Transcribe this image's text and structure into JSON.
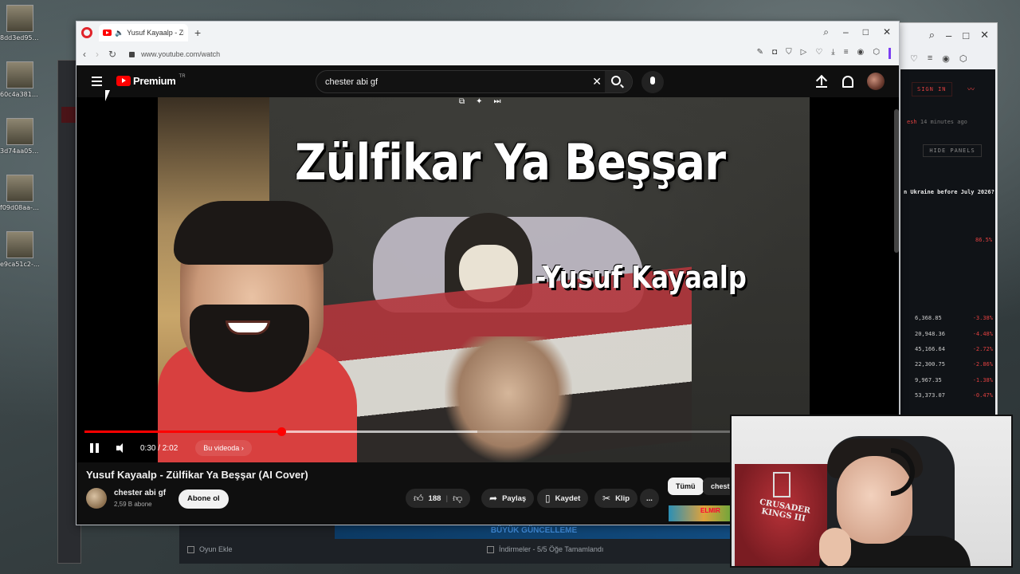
{
  "desktop": {
    "icons": [
      {
        "label": "8dd3ed95-f..."
      },
      {
        "label": "60c4a381-c..."
      },
      {
        "label": "3d74aa05-a..."
      },
      {
        "label": "f09d08aa-b..."
      },
      {
        "label": "e9ca51c2-c..."
      }
    ]
  },
  "browser": {
    "tab_title": "Yusuf Kayaalp - Zülfik",
    "new_tab": "+",
    "url": "www.youtube.com/watch"
  },
  "youtube": {
    "logo_text": "Premium",
    "logo_sup": "TR",
    "search_value": "chester abi gf",
    "video": {
      "overlay_title": "Zülfikar Ya Beşşar",
      "overlay_artist": "-Yusuf Kayaalp",
      "time": "0:30 / 2:02",
      "chapter": "Bu videoda",
      "progress_played": 0.274,
      "progress_buffered": 0.548
    },
    "title": "Yusuf Kayaalp - Zülfikar Ya Beşşar (AI Cover)",
    "channel": {
      "name": "chester abi gf",
      "subs": "2,59 B abone",
      "subscribe": "Abone ol"
    },
    "actions": {
      "likes": "188",
      "share": "Paylaş",
      "save": "Kaydet",
      "clip": "Klip",
      "more": "..."
    },
    "chips": [
      "Tümü",
      "chest"
    ]
  },
  "background": {
    "bottom_banner": "BÜYÜK GÜNCELLEME",
    "add_game": "Oyun Ekle",
    "downloads": "İndirmeler - 5/5 Öğe Tamamlandı",
    "right_panel": {
      "signin": "SIGN IN",
      "meta_red": "esh",
      "meta_time": "14 minutes ago",
      "hide_panels": "HIDE PANELS",
      "question": "n Ukraine before July 2026?",
      "pct": "86.5%",
      "rows": [
        {
          "v": "6,368.85",
          "c": "-3.38%"
        },
        {
          "v": "20,948.36",
          "c": "-4.48%"
        },
        {
          "v": "45,166.64",
          "c": "-2.72%"
        },
        {
          "v": "22,300.75",
          "c": "-2.86%"
        },
        {
          "v": "9,967.35",
          "c": "-1.38%"
        },
        {
          "v": "53,373.07",
          "c": "-0.47%"
        }
      ]
    }
  },
  "webcam": {
    "poster_text_line1": "CRUSADER",
    "poster_text_line2": "KINGS III"
  }
}
